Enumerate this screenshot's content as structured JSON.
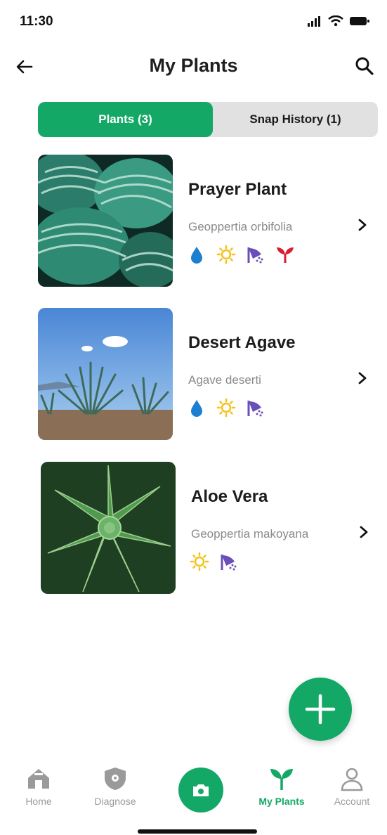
{
  "status_bar": {
    "time": "11:30",
    "icons": [
      "signal-icon",
      "wifi-icon",
      "battery-icon"
    ]
  },
  "header": {
    "title": "My Plants",
    "back_icon": "arrow-left-icon",
    "search_icon": "search-icon"
  },
  "tabs": [
    {
      "label": "Plants (3)",
      "active": true
    },
    {
      "label": "Snap History (1)",
      "active": false
    }
  ],
  "plants": [
    {
      "name": "Prayer Plant",
      "scientific_name": "Geoppertia orbifolia",
      "care_icons": [
        "water-drop-icon",
        "sun-icon",
        "shower-icon",
        "sprout-icon"
      ]
    },
    {
      "name": "Desert Agave",
      "scientific_name": "Agave deserti",
      "care_icons": [
        "water-drop-icon",
        "sun-icon",
        "shower-icon"
      ]
    },
    {
      "name": "Aloe Vera",
      "scientific_name": "Geoppertia makoyana",
      "care_icons": [
        "sun-icon",
        "shower-icon"
      ]
    }
  ],
  "fab": {
    "icon": "plus-icon"
  },
  "bottom_nav": [
    {
      "label": "Home",
      "icon": "home-icon",
      "active": false
    },
    {
      "label": "Diagnose",
      "icon": "shield-icon",
      "active": false
    },
    {
      "label": "",
      "icon": "camera-icon",
      "active": false
    },
    {
      "label": "My Plants",
      "icon": "sprout-icon",
      "active": true
    },
    {
      "label": "Account",
      "icon": "user-icon",
      "active": false
    }
  ],
  "colors": {
    "accent": "#14a866",
    "water": "#1d7fd1",
    "sun": "#f2c21b",
    "shower": "#6b4fb8",
    "sprout": "#d81e34",
    "muted": "#8a8a8a"
  }
}
